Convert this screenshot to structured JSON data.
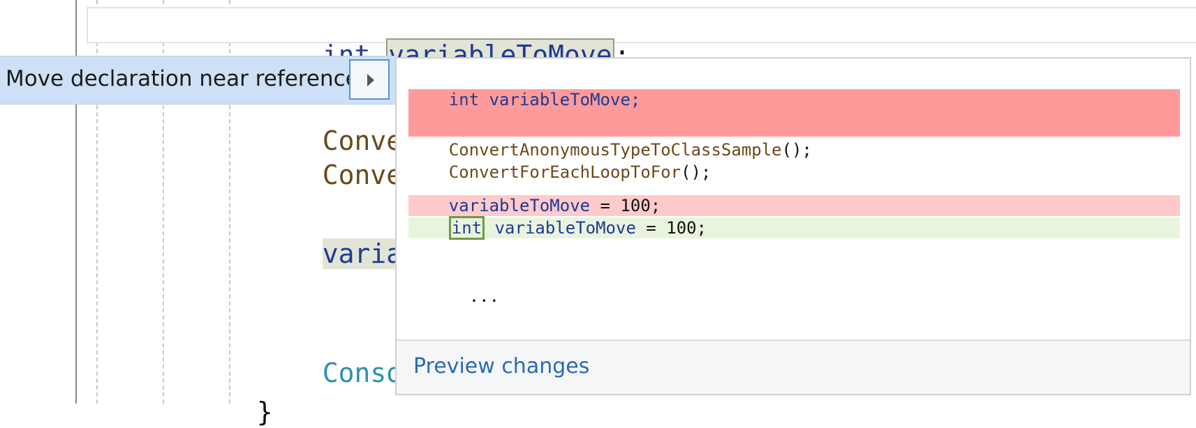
{
  "editor": {
    "line1_keyword": "int",
    "line1_ident": "variableToMove",
    "line1_semicolon": ";",
    "line2_partial": "Conver",
    "line3_partial": "Convert",
    "line4_partial": "variab",
    "line5_partial": "Consol",
    "line6_brace": "}"
  },
  "lightbulb_menu": {
    "item_label": "Move declaration near reference"
  },
  "preview": {
    "open_brace": "{",
    "removed_decl_kw": "int",
    "removed_decl_rest": " variableToMove;",
    "call1": "ConvertAnonymousTypeToClassSample",
    "call1_tail": "();",
    "call2": "ConvertForEachLoopToFor",
    "call2_tail": "();",
    "removed_assign_ident": "variableToMove",
    "removed_assign_rest": " = 100;",
    "added_kw": "int",
    "added_ident": " variableToMove",
    "added_rest": " = 100;",
    "ellipsis": "...",
    "preview_link": "Preview changes"
  },
  "colors": {
    "deleted_strong": "#ff9a9a",
    "deleted_light": "#ffcaca",
    "added": "#e9f4df",
    "link": "#2a6ab8",
    "menu_highlight": "#cde0f5"
  }
}
